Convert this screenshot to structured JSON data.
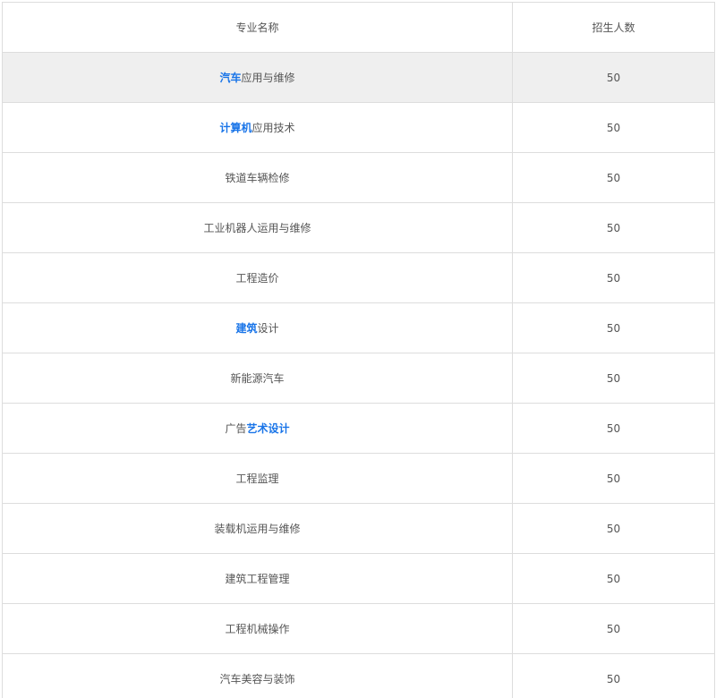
{
  "table": {
    "headers": [
      "专业名称",
      "招生人数"
    ],
    "rows": [
      {
        "name_parts": [
          {
            "text": "汽车",
            "link": true
          },
          {
            "text": "应用与维修",
            "link": false
          }
        ],
        "count": "50",
        "highlighted": true
      },
      {
        "name_parts": [
          {
            "text": "计算机",
            "link": true
          },
          {
            "text": "应用技术",
            "link": false
          }
        ],
        "count": "50",
        "highlighted": false
      },
      {
        "name_parts": [
          {
            "text": "铁道车辆检修",
            "link": false
          }
        ],
        "count": "50",
        "highlighted": false
      },
      {
        "name_parts": [
          {
            "text": "工业机器人运用与维修",
            "link": false
          }
        ],
        "count": "50",
        "highlighted": false
      },
      {
        "name_parts": [
          {
            "text": "工程造价",
            "link": false
          }
        ],
        "count": "50",
        "highlighted": false
      },
      {
        "name_parts": [
          {
            "text": "建筑",
            "link": true
          },
          {
            "text": "设计",
            "link": false
          }
        ],
        "count": "50",
        "highlighted": false
      },
      {
        "name_parts": [
          {
            "text": "新能源汽车",
            "link": false
          }
        ],
        "count": "50",
        "highlighted": false
      },
      {
        "name_parts": [
          {
            "text": "广告",
            "link": false
          },
          {
            "text": "艺术设计",
            "link": true
          }
        ],
        "count": "50",
        "highlighted": false
      },
      {
        "name_parts": [
          {
            "text": "工程监理",
            "link": false
          }
        ],
        "count": "50",
        "highlighted": false
      },
      {
        "name_parts": [
          {
            "text": "装载机运用与维修",
            "link": false
          }
        ],
        "count": "50",
        "highlighted": false
      },
      {
        "name_parts": [
          {
            "text": "建筑工程管理",
            "link": false
          }
        ],
        "count": "50",
        "highlighted": false
      },
      {
        "name_parts": [
          {
            "text": "工程机械操作",
            "link": false
          }
        ],
        "count": "50",
        "highlighted": false
      },
      {
        "name_parts": [
          {
            "text": "汽车美容与装饰",
            "link": false
          }
        ],
        "count": "50",
        "highlighted": false
      }
    ]
  },
  "colors": {
    "link": "#1a75e8",
    "text": "#555555",
    "border": "#dddddd",
    "highlight_row": "#efefef"
  }
}
